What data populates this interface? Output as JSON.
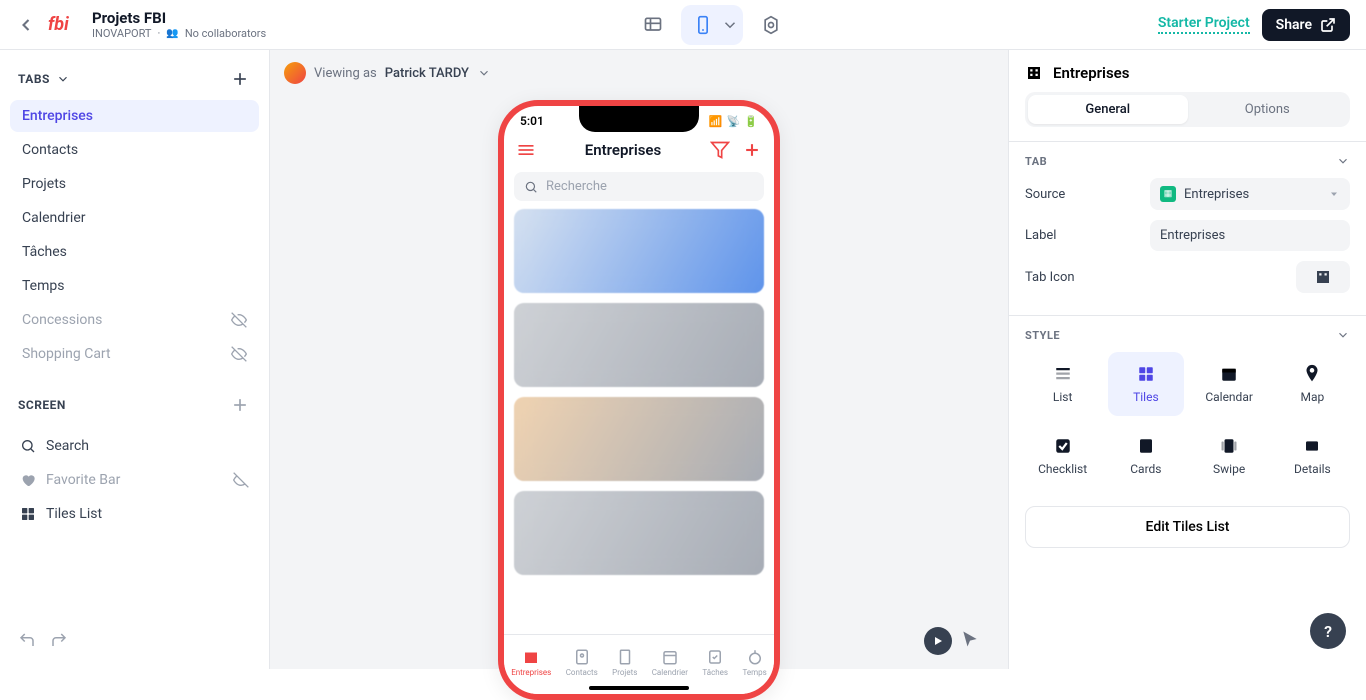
{
  "header": {
    "project_title": "Projets FBI",
    "org": "INOVAPORT",
    "collaborators": "No collaborators",
    "starter": "Starter Project",
    "share": "Share"
  },
  "sidebar": {
    "tabs_label": "TABS",
    "tabs": [
      {
        "label": "Entreprises",
        "active": true
      },
      {
        "label": "Contacts"
      },
      {
        "label": "Projets"
      },
      {
        "label": "Calendrier"
      },
      {
        "label": "Tâches"
      },
      {
        "label": "Temps"
      },
      {
        "label": "Concessions",
        "muted": true,
        "hidden": true
      },
      {
        "label": "Shopping Cart",
        "muted": true,
        "hidden": true
      }
    ],
    "screen_label": "SCREEN",
    "screens": [
      {
        "label": "Search",
        "icon": "search"
      },
      {
        "label": "Favorite Bar",
        "icon": "heart",
        "muted": true,
        "hidden": true
      },
      {
        "label": "Tiles List",
        "icon": "tiles"
      }
    ]
  },
  "canvas": {
    "viewing_prefix": "Viewing as",
    "viewing_user": "Patrick TARDY"
  },
  "phone": {
    "time": "5:01",
    "title": "Entreprises",
    "search_placeholder": "Recherche",
    "tabbar": [
      {
        "label": "Entreprises",
        "active": true
      },
      {
        "label": "Contacts"
      },
      {
        "label": "Projets"
      },
      {
        "label": "Calendrier"
      },
      {
        "label": "Tâches"
      },
      {
        "label": "Temps"
      }
    ]
  },
  "right": {
    "title": "Entreprises",
    "seg_general": "General",
    "seg_options": "Options",
    "section_tab": "TAB",
    "source_label": "Source",
    "source_value": "Entreprises",
    "label_label": "Label",
    "label_value": "Entreprises",
    "tabicon_label": "Tab Icon",
    "section_style": "STYLE",
    "styles": [
      "List",
      "Tiles",
      "Calendar",
      "Map",
      "Checklist",
      "Cards",
      "Swipe",
      "Details"
    ],
    "edit_btn": "Edit Tiles List"
  }
}
